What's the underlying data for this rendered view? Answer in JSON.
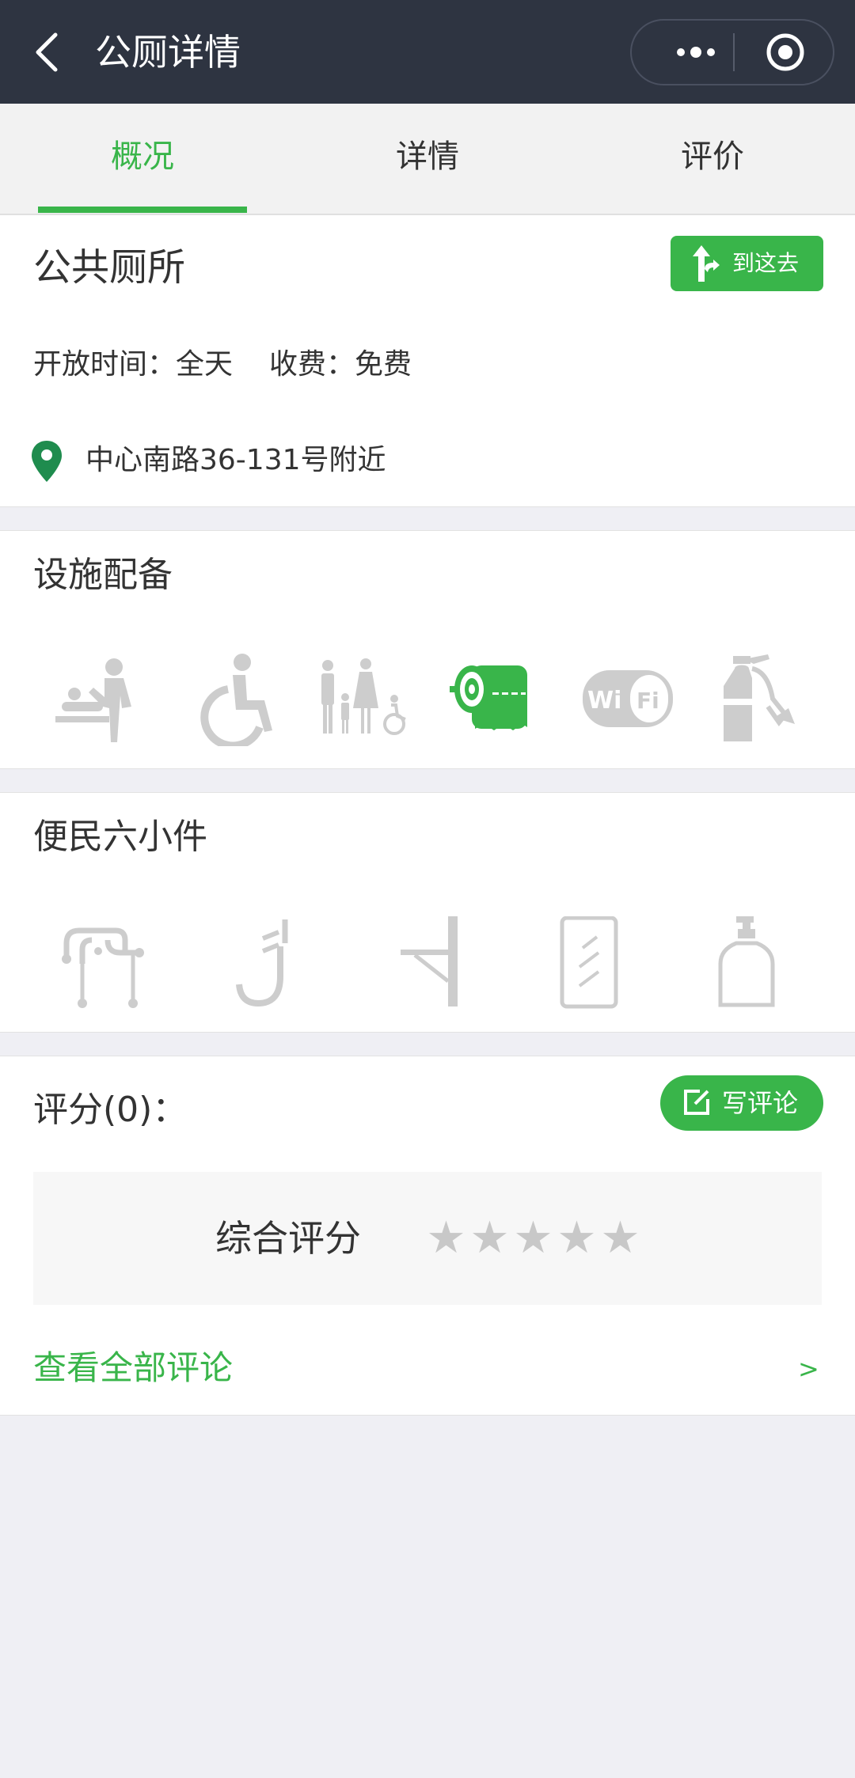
{
  "nav": {
    "title": "公厕详情",
    "back_icon": "chevron-left-icon",
    "more_icon": "more-dots-icon",
    "close_icon": "target-close-icon"
  },
  "tabs": [
    {
      "label": "概况",
      "active": true
    },
    {
      "label": "详情",
      "active": false
    },
    {
      "label": "评价",
      "active": false
    }
  ],
  "overview": {
    "name": "公共厕所",
    "goto_label": "到这去",
    "open_label": "开放时间：",
    "open_value": "全天",
    "fee_label": "收费：",
    "fee_value": "免费",
    "address": "中心南路36-131号附近"
  },
  "facilities": {
    "title": "设施配备",
    "items": [
      {
        "icon": "baby-changing-icon",
        "available": false
      },
      {
        "icon": "wheelchair-icon",
        "available": false
      },
      {
        "icon": "family-restroom-icon",
        "available": false
      },
      {
        "icon": "toilet-paper-icon",
        "available": true
      },
      {
        "icon": "wifi-icon",
        "available": false
      },
      {
        "icon": "fire-extinguisher-icon",
        "available": false
      }
    ]
  },
  "conveniences": {
    "title": "便民六小件",
    "items": [
      {
        "icon": "coat-hooks-icon"
      },
      {
        "icon": "handrail-icon"
      },
      {
        "icon": "shelf-icon"
      },
      {
        "icon": "mirror-icon"
      },
      {
        "icon": "soap-dispenser-icon"
      }
    ]
  },
  "rating": {
    "title": "评分(0)：",
    "write_label": "写评论",
    "overall_label": "综合评分",
    "stars": 0,
    "max_stars": 5,
    "view_all_label": "查看全部评论",
    "view_all_arrow": ">"
  },
  "colors": {
    "accent": "#39b54a",
    "navbar": "#2e3441",
    "inactive_icon": "#cdcdcd"
  }
}
